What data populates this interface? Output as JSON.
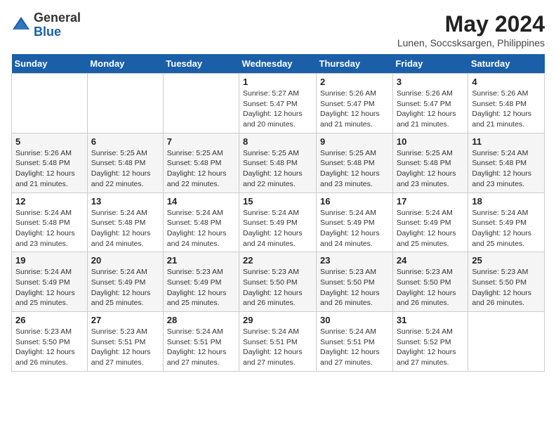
{
  "header": {
    "logo_general": "General",
    "logo_blue": "Blue",
    "month_year": "May 2024",
    "location": "Lunen, Soccsksargen, Philippines"
  },
  "days_of_week": [
    "Sunday",
    "Monday",
    "Tuesday",
    "Wednesday",
    "Thursday",
    "Friday",
    "Saturday"
  ],
  "weeks": [
    [
      {
        "day": "",
        "sunrise": "",
        "sunset": "",
        "daylight": ""
      },
      {
        "day": "",
        "sunrise": "",
        "sunset": "",
        "daylight": ""
      },
      {
        "day": "",
        "sunrise": "",
        "sunset": "",
        "daylight": ""
      },
      {
        "day": "1",
        "sunrise": "Sunrise: 5:27 AM",
        "sunset": "Sunset: 5:47 PM",
        "daylight": "Daylight: 12 hours and 20 minutes."
      },
      {
        "day": "2",
        "sunrise": "Sunrise: 5:26 AM",
        "sunset": "Sunset: 5:47 PM",
        "daylight": "Daylight: 12 hours and 21 minutes."
      },
      {
        "day": "3",
        "sunrise": "Sunrise: 5:26 AM",
        "sunset": "Sunset: 5:47 PM",
        "daylight": "Daylight: 12 hours and 21 minutes."
      },
      {
        "day": "4",
        "sunrise": "Sunrise: 5:26 AM",
        "sunset": "Sunset: 5:48 PM",
        "daylight": "Daylight: 12 hours and 21 minutes."
      }
    ],
    [
      {
        "day": "5",
        "sunrise": "Sunrise: 5:26 AM",
        "sunset": "Sunset: 5:48 PM",
        "daylight": "Daylight: 12 hours and 21 minutes."
      },
      {
        "day": "6",
        "sunrise": "Sunrise: 5:25 AM",
        "sunset": "Sunset: 5:48 PM",
        "daylight": "Daylight: 12 hours and 22 minutes."
      },
      {
        "day": "7",
        "sunrise": "Sunrise: 5:25 AM",
        "sunset": "Sunset: 5:48 PM",
        "daylight": "Daylight: 12 hours and 22 minutes."
      },
      {
        "day": "8",
        "sunrise": "Sunrise: 5:25 AM",
        "sunset": "Sunset: 5:48 PM",
        "daylight": "Daylight: 12 hours and 22 minutes."
      },
      {
        "day": "9",
        "sunrise": "Sunrise: 5:25 AM",
        "sunset": "Sunset: 5:48 PM",
        "daylight": "Daylight: 12 hours and 23 minutes."
      },
      {
        "day": "10",
        "sunrise": "Sunrise: 5:25 AM",
        "sunset": "Sunset: 5:48 PM",
        "daylight": "Daylight: 12 hours and 23 minutes."
      },
      {
        "day": "11",
        "sunrise": "Sunrise: 5:24 AM",
        "sunset": "Sunset: 5:48 PM",
        "daylight": "Daylight: 12 hours and 23 minutes."
      }
    ],
    [
      {
        "day": "12",
        "sunrise": "Sunrise: 5:24 AM",
        "sunset": "Sunset: 5:48 PM",
        "daylight": "Daylight: 12 hours and 23 minutes."
      },
      {
        "day": "13",
        "sunrise": "Sunrise: 5:24 AM",
        "sunset": "Sunset: 5:48 PM",
        "daylight": "Daylight: 12 hours and 24 minutes."
      },
      {
        "day": "14",
        "sunrise": "Sunrise: 5:24 AM",
        "sunset": "Sunset: 5:48 PM",
        "daylight": "Daylight: 12 hours and 24 minutes."
      },
      {
        "day": "15",
        "sunrise": "Sunrise: 5:24 AM",
        "sunset": "Sunset: 5:49 PM",
        "daylight": "Daylight: 12 hours and 24 minutes."
      },
      {
        "day": "16",
        "sunrise": "Sunrise: 5:24 AM",
        "sunset": "Sunset: 5:49 PM",
        "daylight": "Daylight: 12 hours and 24 minutes."
      },
      {
        "day": "17",
        "sunrise": "Sunrise: 5:24 AM",
        "sunset": "Sunset: 5:49 PM",
        "daylight": "Daylight: 12 hours and 25 minutes."
      },
      {
        "day": "18",
        "sunrise": "Sunrise: 5:24 AM",
        "sunset": "Sunset: 5:49 PM",
        "daylight": "Daylight: 12 hours and 25 minutes."
      }
    ],
    [
      {
        "day": "19",
        "sunrise": "Sunrise: 5:24 AM",
        "sunset": "Sunset: 5:49 PM",
        "daylight": "Daylight: 12 hours and 25 minutes."
      },
      {
        "day": "20",
        "sunrise": "Sunrise: 5:24 AM",
        "sunset": "Sunset: 5:49 PM",
        "daylight": "Daylight: 12 hours and 25 minutes."
      },
      {
        "day": "21",
        "sunrise": "Sunrise: 5:23 AM",
        "sunset": "Sunset: 5:49 PM",
        "daylight": "Daylight: 12 hours and 25 minutes."
      },
      {
        "day": "22",
        "sunrise": "Sunrise: 5:23 AM",
        "sunset": "Sunset: 5:50 PM",
        "daylight": "Daylight: 12 hours and 26 minutes."
      },
      {
        "day": "23",
        "sunrise": "Sunrise: 5:23 AM",
        "sunset": "Sunset: 5:50 PM",
        "daylight": "Daylight: 12 hours and 26 minutes."
      },
      {
        "day": "24",
        "sunrise": "Sunrise: 5:23 AM",
        "sunset": "Sunset: 5:50 PM",
        "daylight": "Daylight: 12 hours and 26 minutes."
      },
      {
        "day": "25",
        "sunrise": "Sunrise: 5:23 AM",
        "sunset": "Sunset: 5:50 PM",
        "daylight": "Daylight: 12 hours and 26 minutes."
      }
    ],
    [
      {
        "day": "26",
        "sunrise": "Sunrise: 5:23 AM",
        "sunset": "Sunset: 5:50 PM",
        "daylight": "Daylight: 12 hours and 26 minutes."
      },
      {
        "day": "27",
        "sunrise": "Sunrise: 5:23 AM",
        "sunset": "Sunset: 5:51 PM",
        "daylight": "Daylight: 12 hours and 27 minutes."
      },
      {
        "day": "28",
        "sunrise": "Sunrise: 5:24 AM",
        "sunset": "Sunset: 5:51 PM",
        "daylight": "Daylight: 12 hours and 27 minutes."
      },
      {
        "day": "29",
        "sunrise": "Sunrise: 5:24 AM",
        "sunset": "Sunset: 5:51 PM",
        "daylight": "Daylight: 12 hours and 27 minutes."
      },
      {
        "day": "30",
        "sunrise": "Sunrise: 5:24 AM",
        "sunset": "Sunset: 5:51 PM",
        "daylight": "Daylight: 12 hours and 27 minutes."
      },
      {
        "day": "31",
        "sunrise": "Sunrise: 5:24 AM",
        "sunset": "Sunset: 5:52 PM",
        "daylight": "Daylight: 12 hours and 27 minutes."
      },
      {
        "day": "",
        "sunrise": "",
        "sunset": "",
        "daylight": ""
      }
    ]
  ]
}
